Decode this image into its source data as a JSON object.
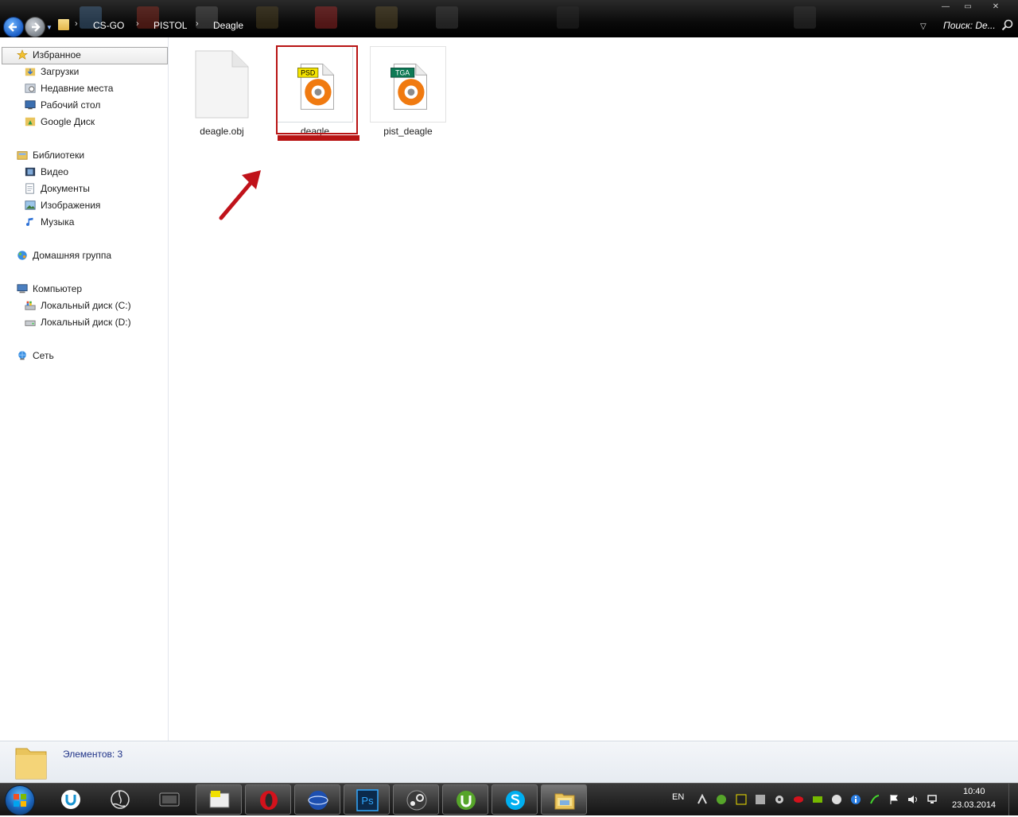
{
  "address_bar": {
    "crumbs": [
      "CS-GO",
      "PISTOL",
      "Deagle"
    ],
    "search_label": "Поиск: De...",
    "window_controls": [
      "—",
      "▭",
      "✕"
    ]
  },
  "nav": {
    "favorites": {
      "label": "Избранное",
      "items": [
        "Загрузки",
        "Недавние места",
        "Рабочий стол",
        "Google Диск"
      ]
    },
    "libraries": {
      "label": "Библиотеки",
      "items": [
        "Видео",
        "Документы",
        "Изображения",
        "Музыка"
      ]
    },
    "homegroup": {
      "label": "Домашняя группа"
    },
    "computer": {
      "label": "Компьютер",
      "items": [
        "Локальный диск (C:)",
        "Локальный диск (D:)"
      ]
    },
    "network": {
      "label": "Сеть"
    }
  },
  "files": [
    {
      "name": "deagle.obj",
      "type": "generic"
    },
    {
      "name": "deagle",
      "type": "psd",
      "badge": "PSD",
      "selected": true
    },
    {
      "name": "pist_deagle",
      "type": "tga",
      "badge": "TGA"
    }
  ],
  "details": {
    "items_count": "Элементов: 3"
  },
  "taskbar": {
    "apps": [
      "uplay-icon",
      "obs-icon",
      "video-icon",
      "gpu-monitor-icon",
      "opera-icon",
      "browser-globe-icon",
      "photoshop-icon",
      "steam-icon",
      "utorrent-icon",
      "skype-icon",
      "explorer-icon"
    ],
    "ps_label": "Ps",
    "lang": "EN",
    "time": "10:40",
    "date": "23.03.2014"
  },
  "colors": {
    "accent_red": "#b81414",
    "psd_badge": "#f5e400",
    "tga_badge": "#0d7a55",
    "disc_orange": "#f07a10"
  }
}
